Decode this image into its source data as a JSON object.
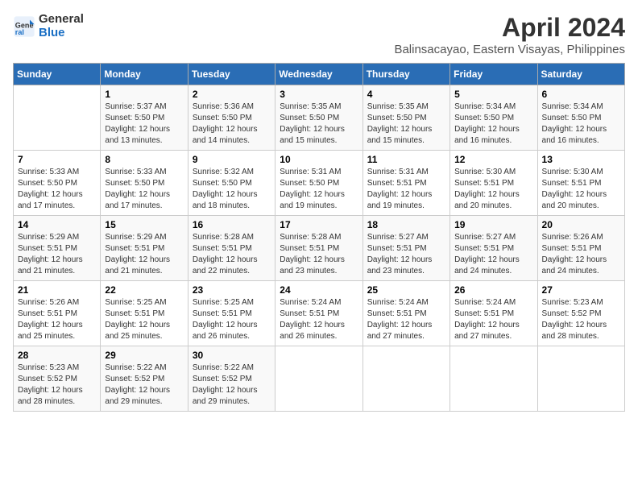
{
  "logo": {
    "line1": "General",
    "line2": "Blue"
  },
  "title": "April 2024",
  "subtitle": "Balinsacayao, Eastern Visayas, Philippines",
  "headers": [
    "Sunday",
    "Monday",
    "Tuesday",
    "Wednesday",
    "Thursday",
    "Friday",
    "Saturday"
  ],
  "weeks": [
    [
      {
        "day": "",
        "info": ""
      },
      {
        "day": "1",
        "info": "Sunrise: 5:37 AM\nSunset: 5:50 PM\nDaylight: 12 hours\nand 13 minutes."
      },
      {
        "day": "2",
        "info": "Sunrise: 5:36 AM\nSunset: 5:50 PM\nDaylight: 12 hours\nand 14 minutes."
      },
      {
        "day": "3",
        "info": "Sunrise: 5:35 AM\nSunset: 5:50 PM\nDaylight: 12 hours\nand 15 minutes."
      },
      {
        "day": "4",
        "info": "Sunrise: 5:35 AM\nSunset: 5:50 PM\nDaylight: 12 hours\nand 15 minutes."
      },
      {
        "day": "5",
        "info": "Sunrise: 5:34 AM\nSunset: 5:50 PM\nDaylight: 12 hours\nand 16 minutes."
      },
      {
        "day": "6",
        "info": "Sunrise: 5:34 AM\nSunset: 5:50 PM\nDaylight: 12 hours\nand 16 minutes."
      }
    ],
    [
      {
        "day": "7",
        "info": "Sunrise: 5:33 AM\nSunset: 5:50 PM\nDaylight: 12 hours\nand 17 minutes."
      },
      {
        "day": "8",
        "info": "Sunrise: 5:33 AM\nSunset: 5:50 PM\nDaylight: 12 hours\nand 17 minutes."
      },
      {
        "day": "9",
        "info": "Sunrise: 5:32 AM\nSunset: 5:50 PM\nDaylight: 12 hours\nand 18 minutes."
      },
      {
        "day": "10",
        "info": "Sunrise: 5:31 AM\nSunset: 5:50 PM\nDaylight: 12 hours\nand 19 minutes."
      },
      {
        "day": "11",
        "info": "Sunrise: 5:31 AM\nSunset: 5:51 PM\nDaylight: 12 hours\nand 19 minutes."
      },
      {
        "day": "12",
        "info": "Sunrise: 5:30 AM\nSunset: 5:51 PM\nDaylight: 12 hours\nand 20 minutes."
      },
      {
        "day": "13",
        "info": "Sunrise: 5:30 AM\nSunset: 5:51 PM\nDaylight: 12 hours\nand 20 minutes."
      }
    ],
    [
      {
        "day": "14",
        "info": "Sunrise: 5:29 AM\nSunset: 5:51 PM\nDaylight: 12 hours\nand 21 minutes."
      },
      {
        "day": "15",
        "info": "Sunrise: 5:29 AM\nSunset: 5:51 PM\nDaylight: 12 hours\nand 21 minutes."
      },
      {
        "day": "16",
        "info": "Sunrise: 5:28 AM\nSunset: 5:51 PM\nDaylight: 12 hours\nand 22 minutes."
      },
      {
        "day": "17",
        "info": "Sunrise: 5:28 AM\nSunset: 5:51 PM\nDaylight: 12 hours\nand 23 minutes."
      },
      {
        "day": "18",
        "info": "Sunrise: 5:27 AM\nSunset: 5:51 PM\nDaylight: 12 hours\nand 23 minutes."
      },
      {
        "day": "19",
        "info": "Sunrise: 5:27 AM\nSunset: 5:51 PM\nDaylight: 12 hours\nand 24 minutes."
      },
      {
        "day": "20",
        "info": "Sunrise: 5:26 AM\nSunset: 5:51 PM\nDaylight: 12 hours\nand 24 minutes."
      }
    ],
    [
      {
        "day": "21",
        "info": "Sunrise: 5:26 AM\nSunset: 5:51 PM\nDaylight: 12 hours\nand 25 minutes."
      },
      {
        "day": "22",
        "info": "Sunrise: 5:25 AM\nSunset: 5:51 PM\nDaylight: 12 hours\nand 25 minutes."
      },
      {
        "day": "23",
        "info": "Sunrise: 5:25 AM\nSunset: 5:51 PM\nDaylight: 12 hours\nand 26 minutes."
      },
      {
        "day": "24",
        "info": "Sunrise: 5:24 AM\nSunset: 5:51 PM\nDaylight: 12 hours\nand 26 minutes."
      },
      {
        "day": "25",
        "info": "Sunrise: 5:24 AM\nSunset: 5:51 PM\nDaylight: 12 hours\nand 27 minutes."
      },
      {
        "day": "26",
        "info": "Sunrise: 5:24 AM\nSunset: 5:51 PM\nDaylight: 12 hours\nand 27 minutes."
      },
      {
        "day": "27",
        "info": "Sunrise: 5:23 AM\nSunset: 5:52 PM\nDaylight: 12 hours\nand 28 minutes."
      }
    ],
    [
      {
        "day": "28",
        "info": "Sunrise: 5:23 AM\nSunset: 5:52 PM\nDaylight: 12 hours\nand 28 minutes."
      },
      {
        "day": "29",
        "info": "Sunrise: 5:22 AM\nSunset: 5:52 PM\nDaylight: 12 hours\nand 29 minutes."
      },
      {
        "day": "30",
        "info": "Sunrise: 5:22 AM\nSunset: 5:52 PM\nDaylight: 12 hours\nand 29 minutes."
      },
      {
        "day": "",
        "info": ""
      },
      {
        "day": "",
        "info": ""
      },
      {
        "day": "",
        "info": ""
      },
      {
        "day": "",
        "info": ""
      }
    ]
  ]
}
